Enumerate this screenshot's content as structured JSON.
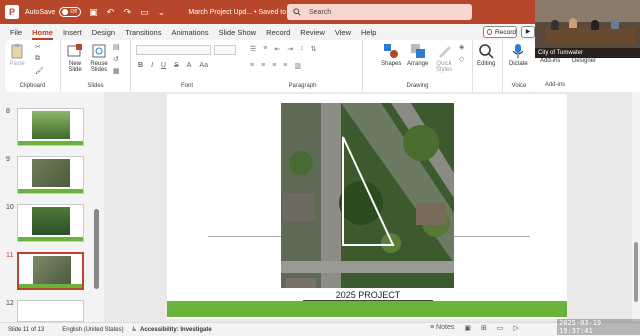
{
  "titlebar": {
    "app_logo": "P",
    "autosave_label": "AutoSave",
    "autosave_state": "Off",
    "doc_title": "March Project Upd... • Saved to this PC ∨",
    "search_placeholder": "Search"
  },
  "menu": {
    "items": [
      "File",
      "Home",
      "Insert",
      "Design",
      "Transitions",
      "Animations",
      "Slide Show",
      "Record",
      "Review",
      "View",
      "Help"
    ],
    "active": "Home",
    "record_label": "Record"
  },
  "ribbon": {
    "clipboard": {
      "paste": "Paste",
      "label": "Clipboard"
    },
    "slides": {
      "new_slide": "New Slide",
      "reuse_slides": "Reuse Slides",
      "label": "Slides"
    },
    "font": {
      "label": "Font",
      "bold": "B",
      "italic": "I",
      "underline": "U",
      "strike": "S"
    },
    "paragraph": {
      "label": "Paragraph"
    },
    "drawing": {
      "shapes": "Shapes",
      "arrange": "Arrange",
      "quick_styles": "Quick Styles",
      "label": "Drawing"
    },
    "editing": {
      "editing": "Editing"
    },
    "voice": {
      "dictate": "Dictate",
      "label": "Voice"
    },
    "addins": {
      "addins": "Add-ins",
      "label": "Add-ins"
    },
    "designer": "Designer"
  },
  "video": {
    "caption": "City of Tumwater"
  },
  "thumbnails": [
    {
      "num": "8",
      "active": false
    },
    {
      "num": "9",
      "active": false
    },
    {
      "num": "10",
      "active": false
    },
    {
      "num": "11",
      "active": true
    },
    {
      "num": "12",
      "active": false
    }
  ],
  "slide": {
    "title": "2025 PROJECT"
  },
  "statusbar": {
    "slide_info": "Slide 11 of 13",
    "language": "English (United States)",
    "accessibility": "Accessibility: Investigate",
    "notes": "Notes"
  },
  "timestamp": "2025-03-19 19:37:41",
  "colors": {
    "accent": "#b7472a",
    "slide_green": "#6bb23a"
  }
}
